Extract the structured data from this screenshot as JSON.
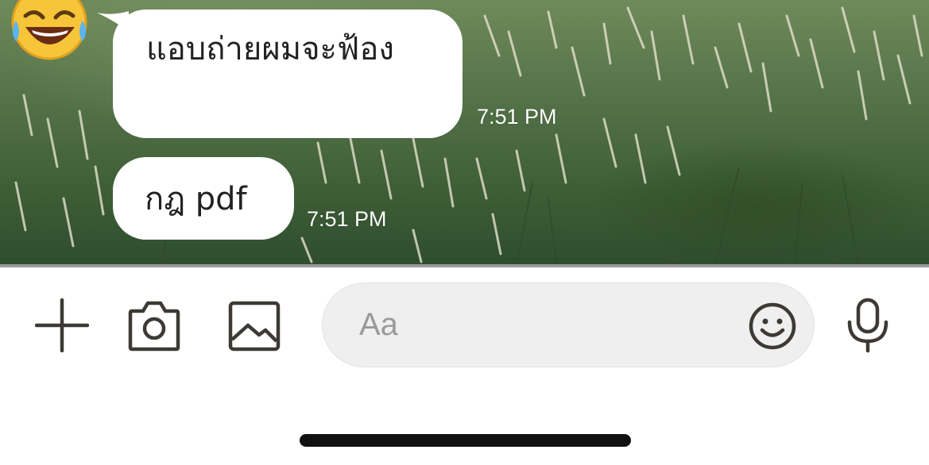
{
  "messages": [
    {
      "text": "แอบถ่ายผมจะฟ้อง",
      "time": "7:51 PM"
    },
    {
      "text": "กฎ pdf",
      "time": "7:51 PM"
    }
  ],
  "sender": {
    "avatar_icon": "laughing-tears-emoji"
  },
  "input_bar": {
    "placeholder": "Aa",
    "icons": [
      "plus-icon",
      "camera-icon",
      "image-icon",
      "emoji-icon",
      "microphone-icon"
    ]
  },
  "colors": {
    "bubble": "#ffffff",
    "input_background": "#efefef",
    "icon": "#3d3a36",
    "timestamp": "#ffffff"
  }
}
